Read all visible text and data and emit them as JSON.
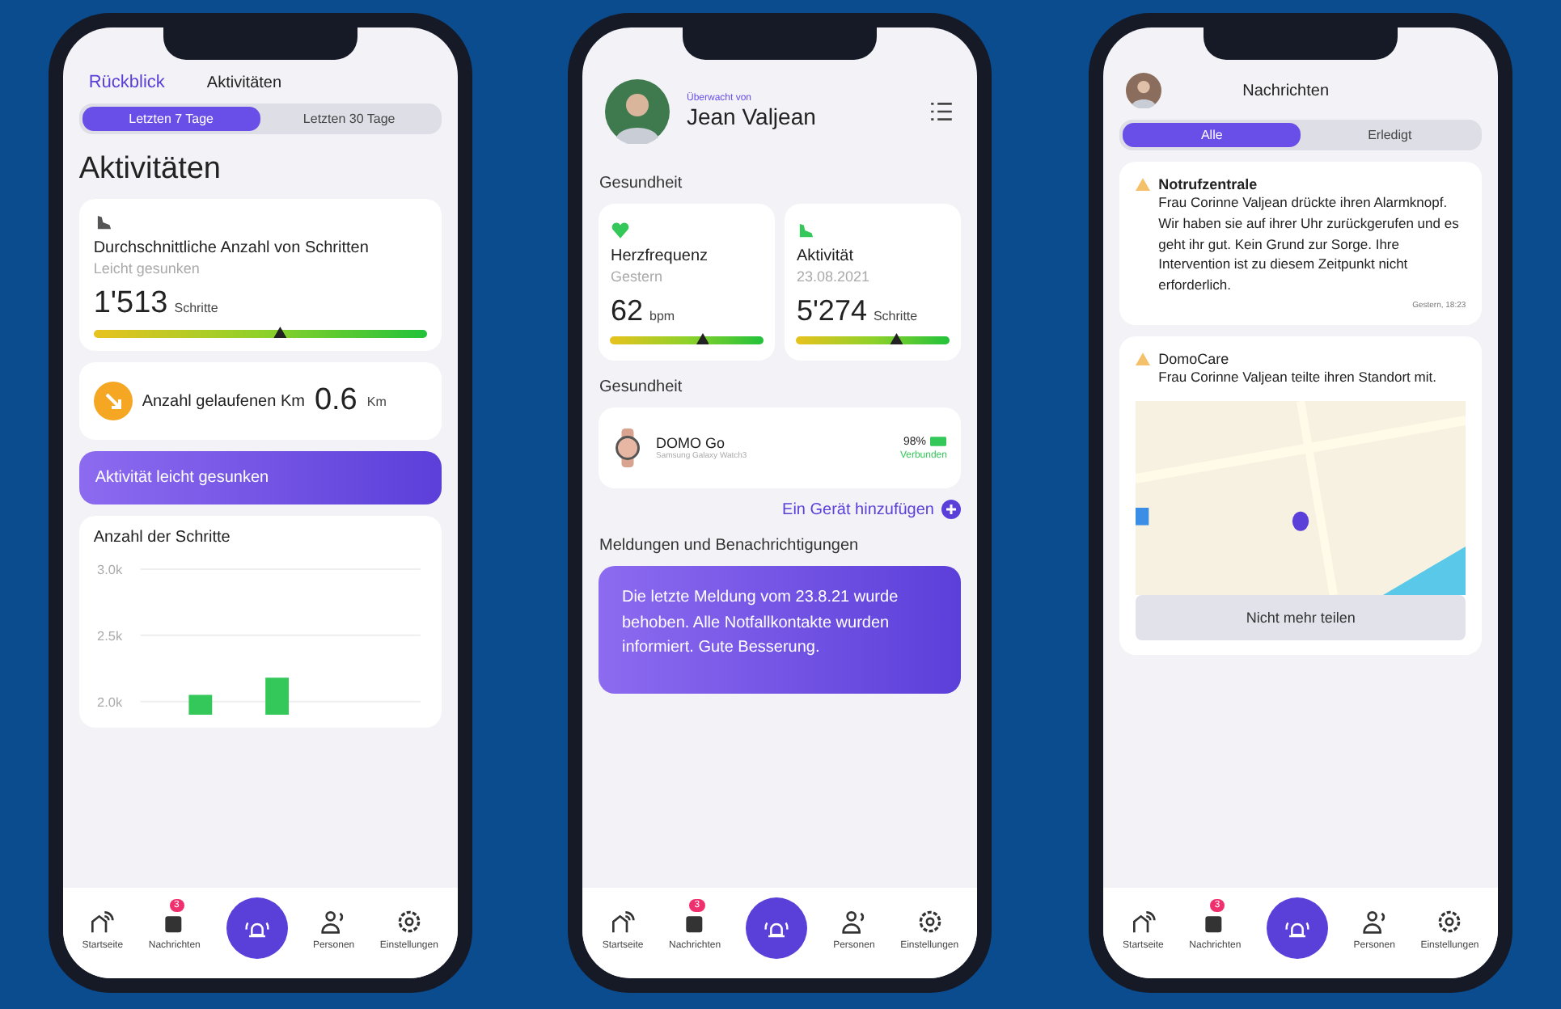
{
  "activity_screen": {
    "back_link": "Rückblick",
    "title": "Aktivitäten",
    "tabs": [
      {
        "label": "Letzten 7 Tage",
        "selected": true
      },
      {
        "label": "Letzten 30 Tage",
        "selected": false
      }
    ],
    "heading": "Aktivitäten",
    "steps_card": {
      "title": "Durchschnittliche Anzahl von Schritten",
      "subtitle": "Leicht gesunken",
      "value": "1'513",
      "unit": "Schritte",
      "level": 0.56
    },
    "distance_card": {
      "label": "Anzahl gelaufenen Km",
      "value": "0.6",
      "unit": "Km"
    },
    "banner": "Aktivität leicht gesunken",
    "chart_card": {
      "chart_data": {
        "type": "bar",
        "title": "Anzahl der Schritte",
        "values": [
          null,
          2050,
          null,
          2180,
          null,
          null,
          null
        ],
        "ylim": [
          1900,
          3000
        ],
        "yticks": [
          {
            "value": 2000,
            "label": "2.0k"
          },
          {
            "value": 2500,
            "label": "2.5k"
          },
          {
            "value": 3000,
            "label": "3.0k"
          }
        ]
      }
    },
    "nav": [
      {
        "kind": "home",
        "label": "Startseite"
      },
      {
        "kind": "messages",
        "label": "Nachrichten",
        "badge": "3"
      },
      {
        "kind": "alarm"
      },
      {
        "kind": "persons",
        "label": "Personen"
      },
      {
        "kind": "settings",
        "label": "Einstellungen"
      }
    ]
  },
  "home_screen": {
    "supervised_label": "Überwacht von",
    "name": "Jean Valjean",
    "section_health": "Gesundheit",
    "metrics": [
      {
        "kind": "heart",
        "title": "Herzfrequenz",
        "subtitle": "Gestern",
        "value": "62",
        "unit": "bpm",
        "level": 0.6
      },
      {
        "kind": "shoe",
        "title": "Aktivität",
        "subtitle": "23.08.2021",
        "value": "5'274",
        "unit": "Schritte",
        "level": 0.65
      }
    ],
    "section_devices": "Gesundheit",
    "device": {
      "name": "DOMO Go",
      "model": "Samsung Galaxy Watch3",
      "battery": "98%",
      "status": "Verbunden"
    },
    "add_device": "Ein Gerät hinzufügen",
    "section_alerts": "Meldungen und Benachrichtigungen",
    "alert_text": "Die letzte Meldung vom 23.8.21 wurde behoben. Alle Notfallkontakte wurden informiert. Gute Besserung.",
    "nav": [
      {
        "kind": "home",
        "label": "Startseite"
      },
      {
        "kind": "messages",
        "label": "Nachrichten",
        "badge": "3"
      },
      {
        "kind": "alarm"
      },
      {
        "kind": "persons",
        "label": "Personen"
      },
      {
        "kind": "settings",
        "label": "Einstellungen"
      }
    ]
  },
  "messages_screen": {
    "title": "Nachrichten",
    "tabs": [
      {
        "label": "Alle",
        "selected": true
      },
      {
        "label": "Erledigt",
        "selected": false
      }
    ],
    "messages": [
      {
        "kind": "text",
        "sender": "Notrufzentrale",
        "text": "Frau Corinne Valjean drückte ihren Alarmknopf. Wir haben sie auf ihrer Uhr zurückgerufen und es geht ihr gut. Kein Grund zur Sorge. Ihre Intervention ist zu diesem Zeitpunkt nicht erforderlich.",
        "time": "Gestern, 18:23"
      },
      {
        "kind": "location",
        "sender": "DomoCare",
        "text": "Frau Corinne Valjean teilte ihren Standort mit.",
        "button": "Nicht mehr teilen"
      }
    ],
    "nav": [
      {
        "kind": "home",
        "label": "Startseite"
      },
      {
        "kind": "messages",
        "label": "Nachrichten",
        "badge": "3"
      },
      {
        "kind": "alarm"
      },
      {
        "kind": "persons",
        "label": "Personen"
      },
      {
        "kind": "settings",
        "label": "Einstellungen"
      }
    ]
  }
}
